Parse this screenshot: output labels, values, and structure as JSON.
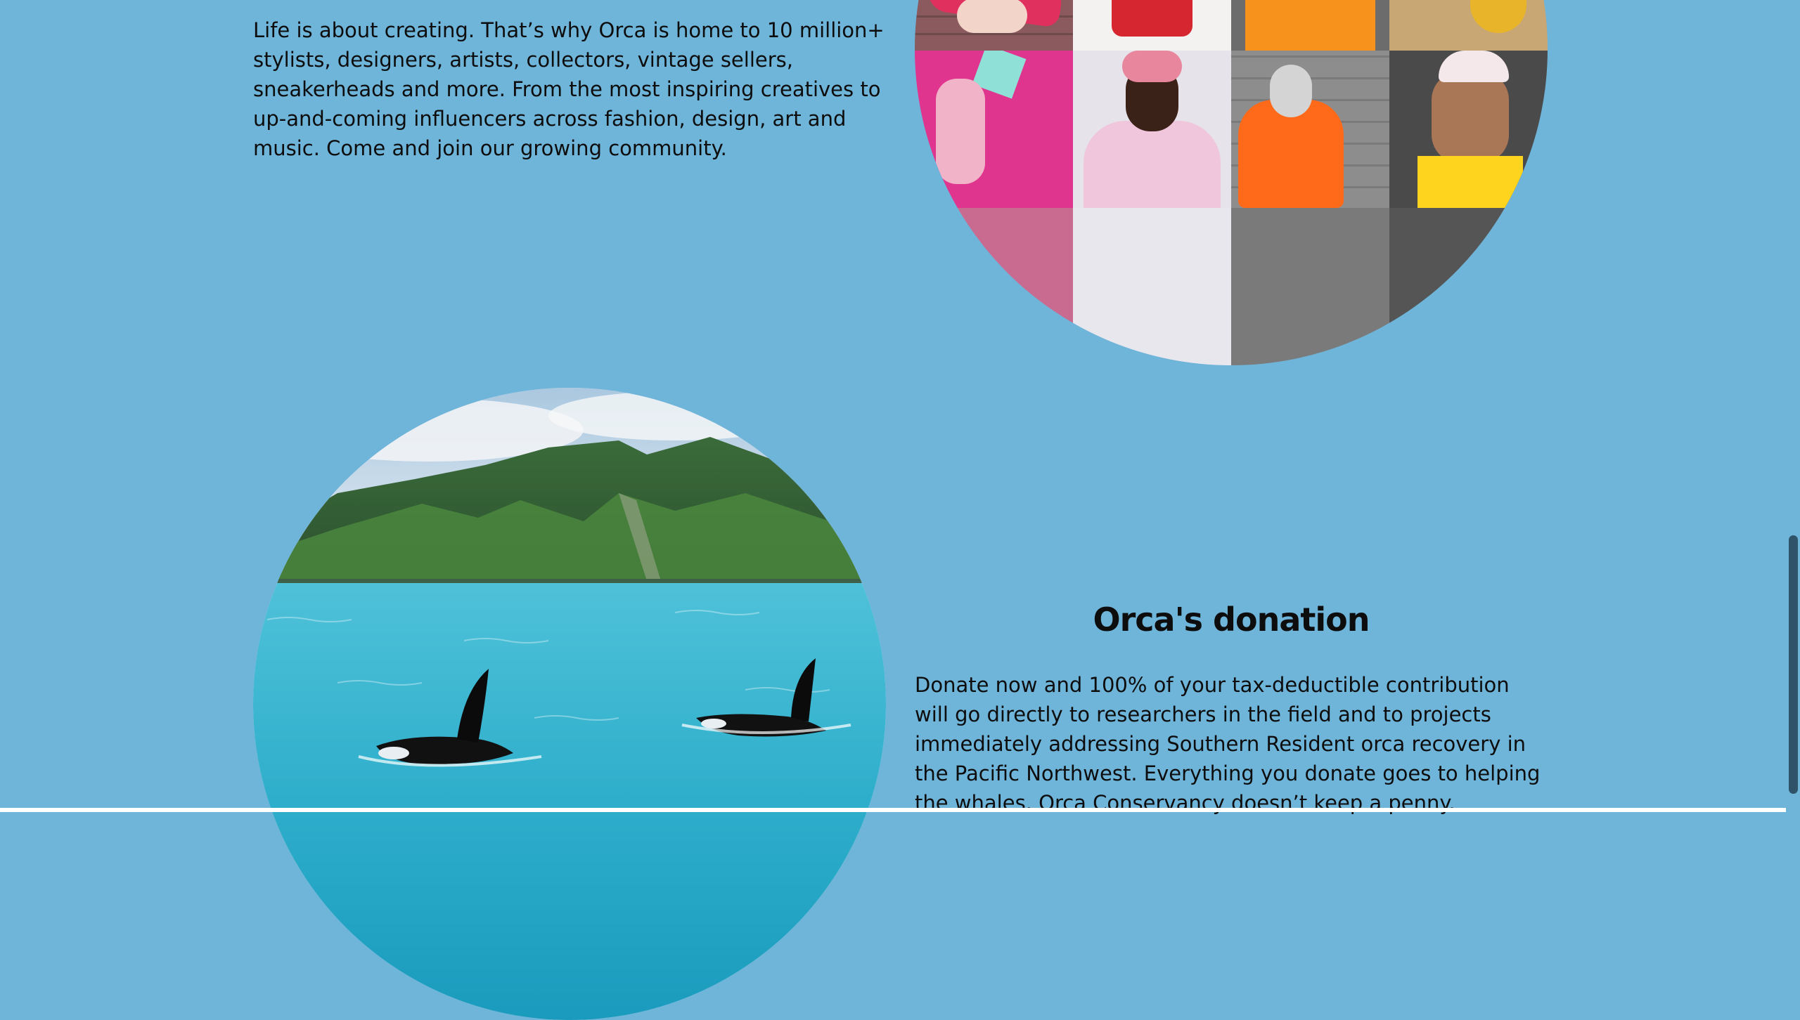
{
  "community": {
    "paragraph": "Life is about creating. That’s why Orca is home to 10 million+ stylists, designers, artists, collectors, vintage sellers, sneakerheads and more. From the most inspiring creatives to up-and-coming influencers across fashion, design, art and music. Come and join our growing community."
  },
  "donation": {
    "title": "Orca's donation",
    "paragraph": "Donate now and 100% of your tax-deductible contribution will go directly to researchers in the field and to projects immediately addressing Southern Resident orca recovery in the Pacific Northwest. Everything you donate goes to helping the whales. Orca Conservancy doesn’t keep a penny."
  },
  "colors": {
    "background": "#6fb4d9",
    "text": "#0d0d0d",
    "scrollbar_thumb": "#2f5368"
  },
  "images": {
    "mosaic": "community-photo-mosaic",
    "orca": "orcas-swimming-near-green-hills"
  }
}
